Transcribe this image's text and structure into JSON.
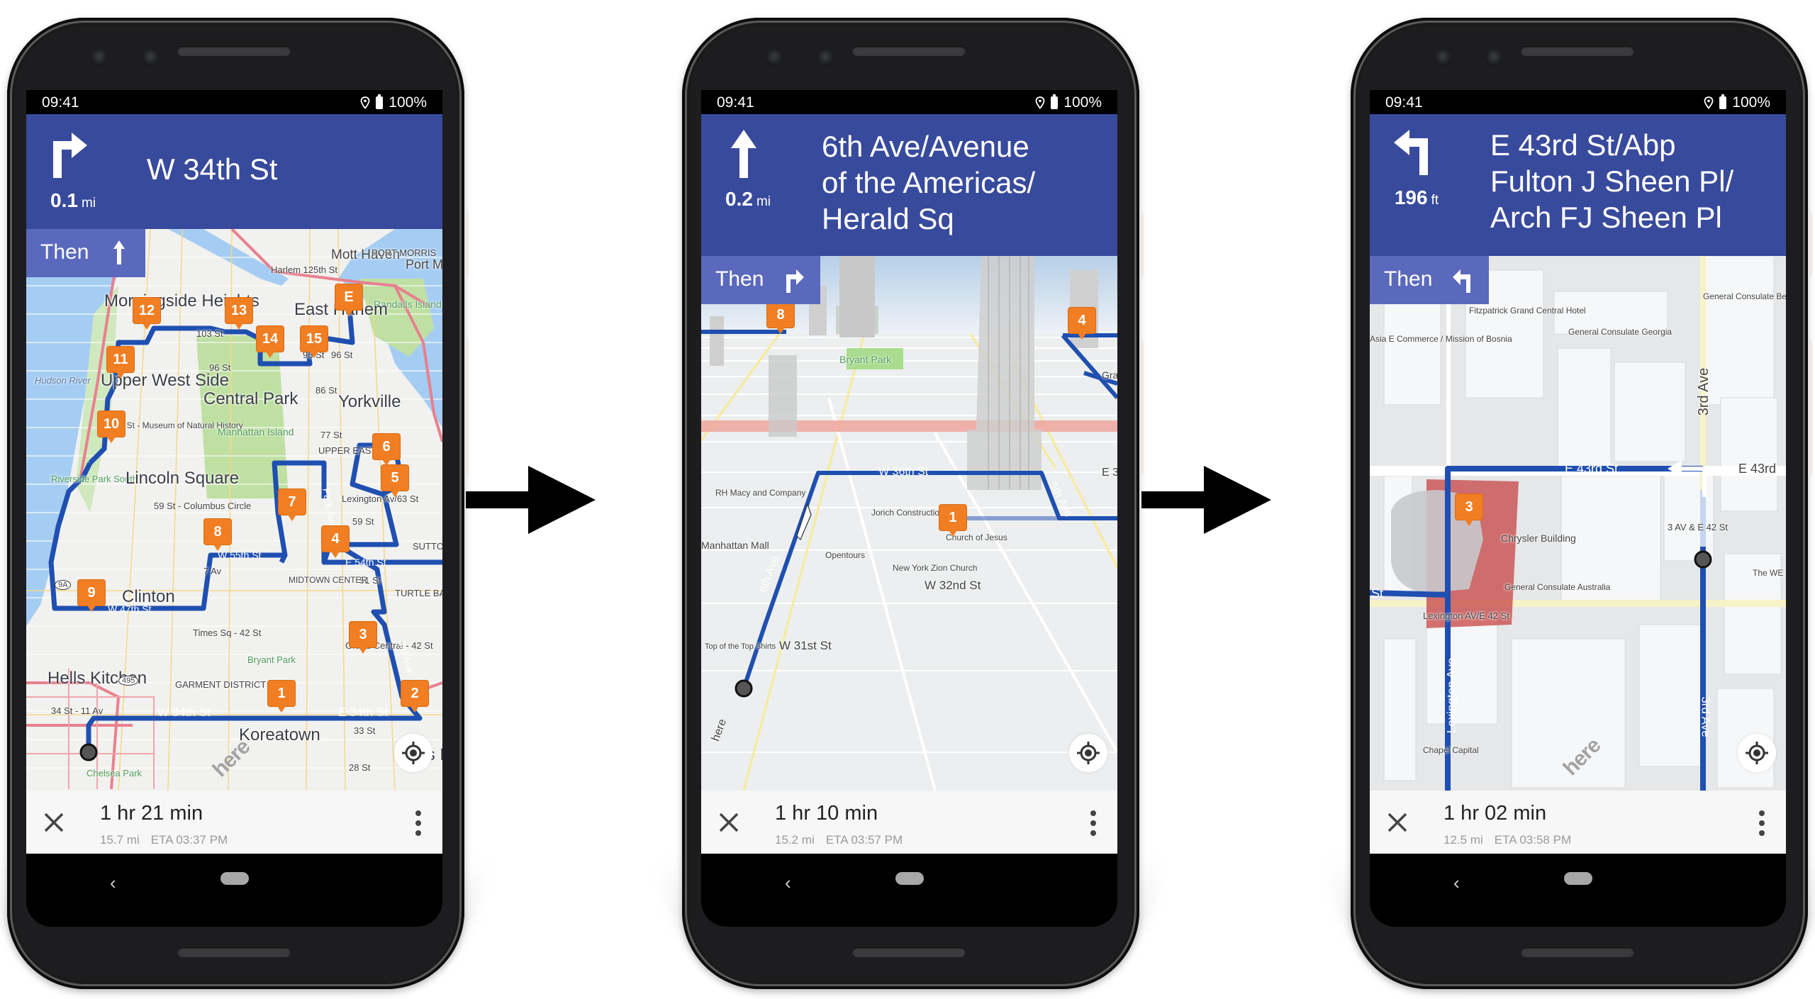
{
  "colors": {
    "header": "#384a9c",
    "then_box": "#5a69bc",
    "route": "#1f4fb0",
    "marker": "#f17e22",
    "map_bg": "#f2f2f2",
    "water": "#9cc9f2",
    "park": "#b9dd9b",
    "highway": "#e8808f"
  },
  "phones": [
    {
      "status": {
        "time": "09:41",
        "battery": "100%"
      },
      "maneuver": {
        "icon": "turn-right-icon",
        "distance": "0.1",
        "unit": "mi",
        "street": "W 34th St"
      },
      "then": {
        "label": "Then",
        "icon": "straight-icon"
      },
      "trip": {
        "duration": "1 hr 21 min",
        "distance": "15.7 mi",
        "eta": "ETA 03:37 PM"
      },
      "map": {
        "view": "2D overview",
        "labels": [
          "Mott Haven",
          "PORT MORRIS",
          "Port Morris",
          "Harlem 125th St",
          "Randalls Island Park",
          "Morningside Heights",
          "East Harlem",
          "103 St",
          "96 St",
          "96 St",
          "96 St",
          "Hudson River",
          "Upper West Side",
          "Central Park",
          "86 St",
          "Yorkville",
          "81 St - Museum of Natural History",
          "Manhattan Island",
          "77 St",
          "UPPER EAST SIDE",
          "Riverside Park South",
          "Lincoln Square",
          "Lexington Av/63 St",
          "59 St - Columbus Circle",
          "59 St",
          "SUTTON PLACE",
          "W 55th St",
          "7 Av",
          "E 54th St",
          "51 St",
          "MIDTOWN CENTER",
          "TURTLE BAY",
          "Clinton",
          "9A",
          "W 47th St",
          "Times Sq - 42 St",
          "Grand Central - 42 St",
          "Bryant Park",
          "3rd Ave",
          "Park Ave",
          "Hells Kitchen",
          "495",
          "GARMENT DISTRICT",
          "34 St - 11 Av",
          "W 34th St",
          "E 34th St",
          "Koreatown",
          "33 St",
          "Kips Bay",
          "28 St",
          "Chelsea Park",
          "here"
        ],
        "markers": [
          "E",
          "12",
          "13",
          "14",
          "15",
          "11",
          "10",
          "6",
          "5",
          "7",
          "8",
          "4",
          "9",
          "3",
          "1",
          "2"
        ]
      }
    },
    {
      "status": {
        "time": "09:41",
        "battery": "100%"
      },
      "maneuver": {
        "icon": "straight-icon",
        "distance": "0.2",
        "unit": "mi",
        "street_lines": [
          "6th Ave/Avenue",
          "of the Americas/",
          "Herald Sq"
        ]
      },
      "then": {
        "label": "Then",
        "icon": "turn-right-icon"
      },
      "trip": {
        "duration": "1 hr 10 min",
        "distance": "15.2 mi",
        "eta": "ETA 03:57 PM"
      },
      "map": {
        "view": "3D perspective",
        "labels": [
          "Bryant Park",
          "W 36th St",
          "5th Ave",
          "E 3",
          "Gra",
          "RH Macy and Company",
          "Jorich Construction",
          "Church of Jesus",
          "Manhattan Mall",
          "Opentours",
          "New York Zion Church",
          "W 32nd St",
          "6th Ave",
          "W 31st St",
          "Top of the Top Shirts",
          "here"
        ],
        "markers": [
          "8",
          "4",
          "1"
        ]
      }
    },
    {
      "status": {
        "time": "09:41",
        "battery": "100%"
      },
      "maneuver": {
        "icon": "turn-left-icon",
        "distance": "196",
        "unit": "ft",
        "street_lines": [
          "E 43rd St/Abp",
          "Fulton J Sheen Pl/",
          "Arch FJ Sheen Pl"
        ]
      },
      "then": {
        "label": "Then",
        "icon": "turn-left-icon"
      },
      "trip": {
        "duration": "1 hr 02 min",
        "distance": "12.5 mi",
        "eta": "ETA 03:58 PM"
      },
      "map": {
        "view": "3D close-up",
        "labels": [
          "Fitzpatrick Grand Central Hotel",
          "General Consulate Belarus",
          "Asia E Commerce / Mission of Bosnia",
          "General Consulate Georgia",
          "3rd Ave",
          "E 43rd St",
          "E 43rd",
          "Chrysler Building",
          "3 AV & E 42 St",
          "General Consulate Australia",
          "The WE York Ce",
          "St",
          "Lexington AV/E 42 St",
          "Lexington Ave",
          "3rd Ave",
          "Chapel Capital",
          "here"
        ],
        "markers": [
          "3"
        ]
      }
    }
  ]
}
